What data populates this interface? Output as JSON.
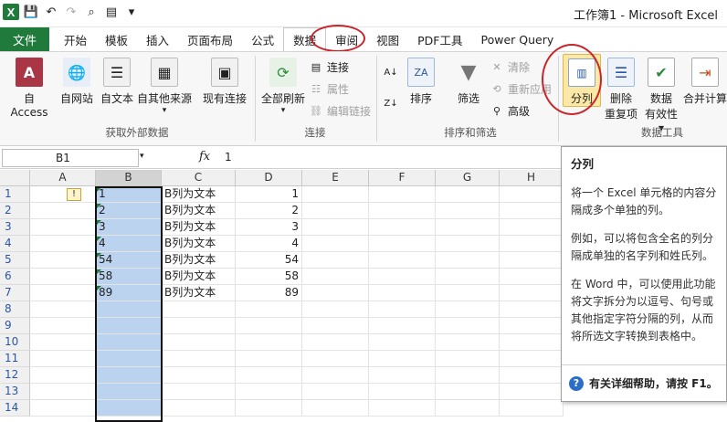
{
  "window": {
    "title": "工作簿1 - Microsoft Excel"
  },
  "tabs": [
    "开始",
    "模板",
    "插入",
    "页面布局",
    "公式",
    "数据",
    "审阅",
    "视图",
    "PDF工具",
    "Power Query"
  ],
  "file_tab": "文件",
  "ribbon": {
    "get_external": {
      "access": "自 Access",
      "web": "自网站",
      "text": "自文本",
      "other": "自其他来源",
      "existing": "现有连接",
      "group_label": "获取外部数据"
    },
    "connections": {
      "refresh_all": "全部刷新",
      "connections": "连接",
      "properties": "属性",
      "edit_links": "编辑链接",
      "group_label": "连接"
    },
    "sort_filter": {
      "sort": "排序",
      "filter": "筛选",
      "clear": "清除",
      "reapply": "重新应用",
      "advanced": "高级",
      "group_label": "排序和筛选"
    },
    "data_tools": {
      "split": "分列",
      "remove_dup_1": "删除",
      "remove_dup_2": "重复项",
      "validation_1": "数据",
      "validation_2": "有效性",
      "consolidate": "合并计算",
      "group_label": "数据工具"
    }
  },
  "formula_bar": {
    "name_box": "B1",
    "fx": "fx",
    "value": "1"
  },
  "columns": [
    "A",
    "B",
    "C",
    "D",
    "E",
    "F",
    "G",
    "H"
  ],
  "rows": [
    "1",
    "2",
    "3",
    "4",
    "5",
    "6",
    "7",
    "8",
    "9",
    "10",
    "11",
    "12",
    "13",
    "14"
  ],
  "cells": {
    "B": [
      "1",
      "2",
      "3",
      "4",
      "54",
      "58",
      "89"
    ],
    "C": [
      "B列为文本",
      "B列为文本",
      "B列为文本",
      "B列为文本",
      "B列为文本",
      "B列为文本",
      "B列为文本"
    ],
    "D": [
      "1",
      "2",
      "3",
      "4",
      "54",
      "58",
      "89"
    ]
  },
  "tooltip": {
    "title": "分列",
    "p1": "将一个 Excel 单元格的内容分隔成多个单独的列。",
    "p2": "例如，可以将包含全名的列分隔成单独的名字列和姓氏列。",
    "p3": "在 Word 中，可以使用此功能将文字拆分为以逗号、句号或其他指定字符分隔的列，从而将所选文字转换到表格中。",
    "help": "有关详细帮助，请按 F1。"
  },
  "colors": {
    "file_tab": "#1f7a3b",
    "selection": "#bcd3ef",
    "highlight_circle": "#c8262c"
  }
}
